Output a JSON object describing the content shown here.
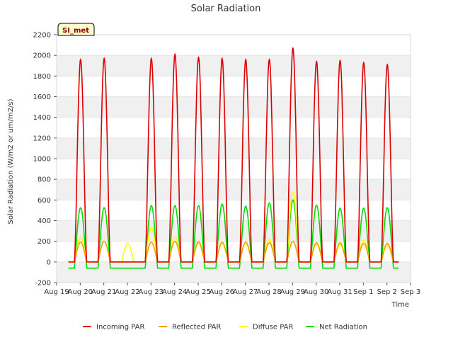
{
  "chart_data": {
    "type": "line",
    "title": "Solar Radiation",
    "xlabel": "Time",
    "ylabel": "Solar Radiation (W/m2 or um/m2/s)",
    "station_badge": "SI_met",
    "ylim": [
      -200,
      2200
    ],
    "yticks": [
      -200,
      0,
      200,
      400,
      600,
      800,
      1000,
      1200,
      1400,
      1600,
      1800,
      2000,
      2200
    ],
    "xlim": [
      0,
      15
    ],
    "xticks": [
      {
        "v": 0,
        "label": "Aug 19"
      },
      {
        "v": 1,
        "label": "Aug 20"
      },
      {
        "v": 2,
        "label": "Aug 21"
      },
      {
        "v": 3,
        "label": "Aug 22"
      },
      {
        "v": 4,
        "label": "Aug 23"
      },
      {
        "v": 5,
        "label": "Aug 24"
      },
      {
        "v": 6,
        "label": "Aug 25"
      },
      {
        "v": 7,
        "label": "Aug 26"
      },
      {
        "v": 8,
        "label": "Aug 27"
      },
      {
        "v": 9,
        "label": "Aug 28"
      },
      {
        "v": 10,
        "label": "Aug 29"
      },
      {
        "v": 11,
        "label": "Aug 30"
      },
      {
        "v": 12,
        "label": "Aug 31"
      },
      {
        "v": 13,
        "label": "Sep 1"
      },
      {
        "v": 14,
        "label": "Sep 2"
      },
      {
        "v": 15,
        "label": "Sep 3"
      }
    ],
    "grid_bands": true,
    "legend_position": "bottom",
    "series": [
      {
        "name": "Incoming PAR",
        "color": "#dd0000",
        "daily_peak": [
          1960,
          1970,
          null,
          1970,
          2010,
          1980,
          1970,
          1960,
          1960,
          2070,
          1940,
          1950,
          1930,
          1910
        ],
        "night": 0
      },
      {
        "name": "Reflected PAR",
        "color": "#ff9900",
        "daily_peak": [
          190,
          200,
          0,
          190,
          200,
          195,
          190,
          190,
          185,
          200,
          185,
          185,
          180,
          180
        ],
        "night": 0
      },
      {
        "name": "Diffuse PAR",
        "color": "#ffff00",
        "daily_peak": [
          240,
          200,
          180,
          330,
          240,
          180,
          180,
          180,
          220,
          680,
          170,
          170,
          210,
          160
        ],
        "night": 0
      },
      {
        "name": "Net Radiation",
        "color": "#00dd00",
        "daily_peak": [
          525,
          525,
          null,
          545,
          545,
          545,
          560,
          540,
          570,
          600,
          550,
          520,
          520,
          525
        ],
        "night": -60
      }
    ]
  }
}
